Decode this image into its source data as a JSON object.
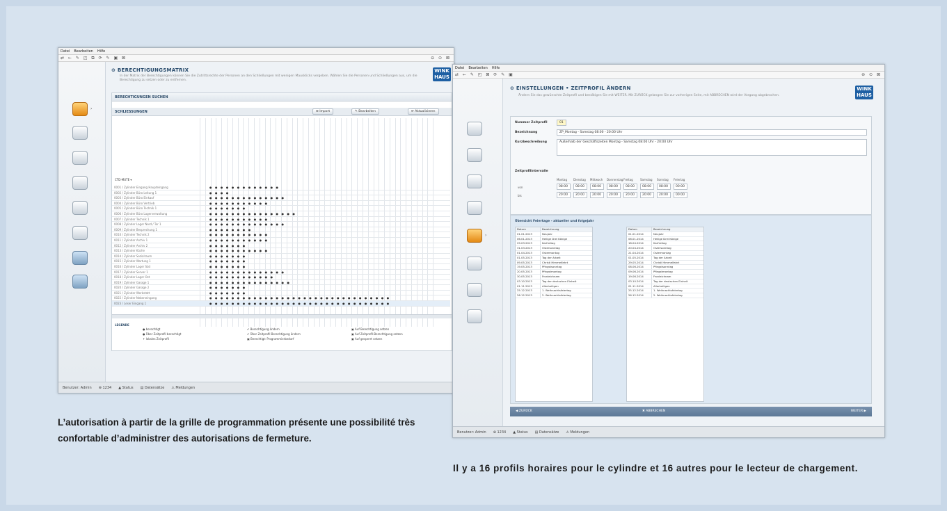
{
  "left_window": {
    "menu": [
      "Datei",
      "Bearbeiten",
      "Hilfe"
    ],
    "toolbar_icons": "⇄ ← ✎ ◰ ⧉ ⟳ ✎ ▣ ⊠",
    "window_controls": "⊖ ⊙ ⊠",
    "page_title": "BERECHTIGUNGSMATRIX",
    "description": "In der Matrix der Berechtigungen können Sie die Zutrittsrechte der Personen an den Schließungen mit wenigen Mausklicks vergeben. Wählen Sie die Personen und Schließungen aus, um die Berechtigung zu setzen oder zu entfernen.",
    "section_header": "BERECHTIGUNGEN SUCHEN",
    "subheader": "SCHLIESSUNGEN",
    "buttons": [
      "⊕ Import",
      "✎ Bearbeiten",
      "⟳ Aktualisieren"
    ],
    "column_header": "CTD-MUTE ▾",
    "rows": [
      "0001 / Zylinder Eingang Haupteingang",
      "0002 / Zylinder Büro Leitung 1",
      "0003 / Zylinder Büro Einkauf",
      "0004 / Zylinder Büro Vertrieb",
      "0005 / Zylinder Büro Technik 1",
      "0006 / Zylinder Büro Lagerverwaltung",
      "0007 / Zylinder Technik 1",
      "0008 / Zylinder Lager Nord / Tor 1",
      "0009 / Zylinder Besprechung 1",
      "0010 / Zylinder Technik 2",
      "0011 / Zylinder Archiv 1",
      "0012 / Zylinder Archiv 2",
      "0013 / Zylinder Küche",
      "0014 / Zylinder Sozialraum",
      "0015 / Zylinder Wartung 1",
      "0016 / Zylinder Lager Süd",
      "0017 / Zylinder Server 1",
      "0018 / Zylinder Lager Ost",
      "0019 / Zylinder Garage 1",
      "0020 / Zylinder Garage 2",
      "0021 / Zylinder Werkstatt",
      "0022 / Zylinder Nebeneingang",
      "0023 / Leser Eingang 1"
    ],
    "legend_title": "LEGENDE",
    "legend": [
      "● berechtigt",
      "● Über Zeitprofil berechtigt",
      "↑ lokales Zeitprofil",
      "✔ Berechtigung ändern",
      "✔ Über Zeitprofil Berechtigung ändern",
      "▣ Berechtigt: Programmierbedarf",
      "▣ Auf Berechtigung setzen",
      "▣ Auf Zeitprofil-Berechtigung setzen",
      "▣ Auf gesperrt setzen"
    ],
    "status": [
      "Benutzer: Admin",
      "⊕ 1234",
      "▲ Status",
      "▤ Datensätze",
      "⚠ Meldungen"
    ]
  },
  "right_window": {
    "menu": [
      "Datei",
      "Bearbeiten",
      "Hilfe"
    ],
    "toolbar_icons": "⇄ ← ✎ ◰ ⊠ ⟳ ✎ ▣",
    "window_controls": "⊖ ⊙ ⊠",
    "page_title": "EINSTELLUNGEN • ZEITPROFIL ÄNDERN",
    "description": "Ändern Sie das gewünschte Zeitprofil und bestätigen Sie mit WEITER. Mit ZURÜCK gelangen Sie zur vorherigen Seite, mit ABBRECHEN wird der Vorgang abgebrochen.",
    "labels": {
      "name": "Nummer Zeitprofil",
      "name_value": "01",
      "description": "Bezeichnung",
      "description_value": "ZP_Montag - Samstag 08:00 - 20:00 Uhr",
      "notes": "Kurzbeschreibung",
      "notes_value": "Außerhalb der Geschäftszeiten Montag - Samstag 08:00 Uhr - 20:00 Uhr",
      "times_title": "Zeitprofilintervalle",
      "from": "von",
      "to": "bis"
    },
    "days": [
      "Montag",
      "Dienstag",
      "Mittwoch",
      "Donnerstag",
      "Freitag",
      "Samstag",
      "Sonntag",
      "Feiertag"
    ],
    "from_times": [
      "08:00",
      "08:00",
      "08:00",
      "08:00",
      "08:00",
      "08:00",
      "08:00",
      "00:00"
    ],
    "to_times": [
      "20:00",
      "20:00",
      "20:00",
      "20:00",
      "20:00",
      "20:00",
      "20:00",
      "00:00"
    ],
    "holidays_title": "Übersicht Feiertage - aktueller und folgejahr",
    "holiday_headers": [
      "Datum",
      "Bezeichnung"
    ],
    "holidays_2013": [
      [
        "01.01.2013",
        "Neujahr"
      ],
      [
        "06.01.2013",
        "Heilige Drei Könige"
      ],
      [
        "29.03.2013",
        "Karfreitag"
      ],
      [
        "31.03.2013",
        "Ostersonntag"
      ],
      [
        "01.04.2013",
        "Ostermontag"
      ],
      [
        "01.05.2013",
        "Tag der Arbeit"
      ],
      [
        "09.05.2013",
        "Christi Himmelfahrt"
      ],
      [
        "19.05.2013",
        "Pfingstsonntag"
      ],
      [
        "20.05.2013",
        "Pfingstmontag"
      ],
      [
        "30.05.2013",
        "Fronleichnam"
      ],
      [
        "03.10.2013",
        "Tag der deutschen Einheit"
      ],
      [
        "01.11.2013",
        "Allerheiligen"
      ],
      [
        "25.12.2013",
        "1. Weihnachtsfeiertag"
      ],
      [
        "26.12.2013",
        "2. Weihnachtsfeiertag"
      ]
    ],
    "holidays_2014": [
      [
        "01.01.2014",
        "Neujahr"
      ],
      [
        "06.01.2014",
        "Heilige Drei Könige"
      ],
      [
        "18.04.2014",
        "Karfreitag"
      ],
      [
        "20.04.2014",
        "Ostersonntag"
      ],
      [
        "21.04.2014",
        "Ostermontag"
      ],
      [
        "01.05.2014",
        "Tag der Arbeit"
      ],
      [
        "29.05.2014",
        "Christi Himmelfahrt"
      ],
      [
        "08.06.2014",
        "Pfingstsonntag"
      ],
      [
        "09.06.2014",
        "Pfingstmontag"
      ],
      [
        "19.06.2014",
        "Fronleichnam"
      ],
      [
        "03.10.2014",
        "Tag der deutschen Einheit"
      ],
      [
        "01.11.2014",
        "Allerheiligen"
      ],
      [
        "25.12.2014",
        "1. Weihnachtsfeiertag"
      ],
      [
        "26.12.2014",
        "2. Weihnachtsfeiertag"
      ]
    ],
    "bottom": {
      "back": "◀ ZURÜCK",
      "cancel": "✖ ABBRECHEN",
      "next": "WEITER ▶"
    },
    "status": [
      "Benutzer: Admin",
      "⊕ 1234",
      "▲ Status",
      "▤ Datensätze",
      "⚠ Meldungen"
    ]
  },
  "logo_text": "WINK HAUS",
  "captions": {
    "left": "L’autorisation à partir de la grille de programmation présente une possibilité très confortable d’administrer des autorisations de fermeture.",
    "right": "Il y a 16 profils horaires pour le cylindre et 16 autres pour le lecteur de chargement."
  },
  "colors": {
    "page_bg": "#c9d8e8",
    "panel_bg": "#d7e3ef",
    "accent_blue": "#1d5fa3",
    "orange_icon": "#e48a14"
  }
}
